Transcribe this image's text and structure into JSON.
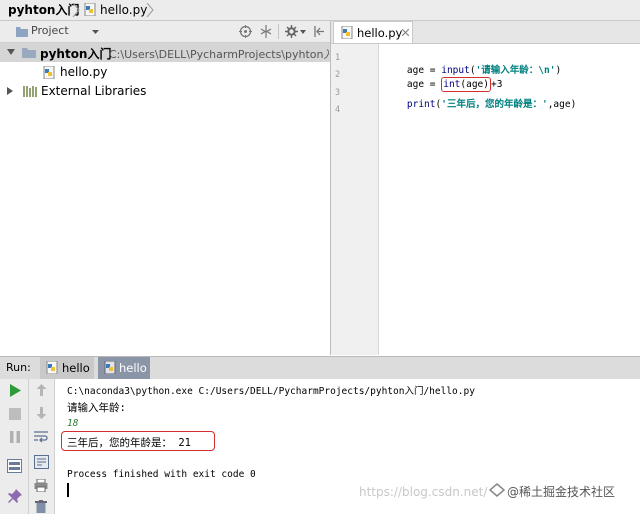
{
  "breadcrumb": {
    "project": "pyhton入门",
    "file": "hello.py"
  },
  "project_panel": {
    "title": "Project",
    "root": {
      "name": "pyhton入门",
      "path": "C:\\Users\\DELL\\PycharmProjects\\pyhton入门"
    },
    "file": "hello.py",
    "external": "External Libraries"
  },
  "editor": {
    "tab": "hello.py",
    "line_numbers": [
      "1",
      "2",
      "3",
      "4"
    ],
    "lines": [
      {
        "a": "age = ",
        "fn": "input",
        "p1": "(",
        "s": "'请输入年龄：\\n'",
        "p2": ")"
      },
      {
        "a": "age = ",
        "fn": "int",
        "p1": "(age)",
        "rest": "+3"
      },
      {
        "fn": "print",
        "p1": "(",
        "s": "'三年后，您的年龄是：'",
        "rest": ",age)"
      }
    ]
  },
  "run": {
    "label": "Run:",
    "tabs": [
      "hello",
      "hello"
    ],
    "console": [
      "C:\\naconda3\\python.exe C:/Users/DELL/PycharmProjects/pyhton入门/hello.py",
      "请输入年龄:",
      "18",
      "三年后，您的年龄是： 21",
      "Process finished with exit code 0"
    ]
  },
  "watermark": "https://blog.csdn.net/",
  "watermark_brand": "@稀土掘金技术社区",
  "colors": {
    "input_green": "#2e7d32",
    "highlight_red": "#d32f2f",
    "run_green": "#2e9b3a"
  }
}
